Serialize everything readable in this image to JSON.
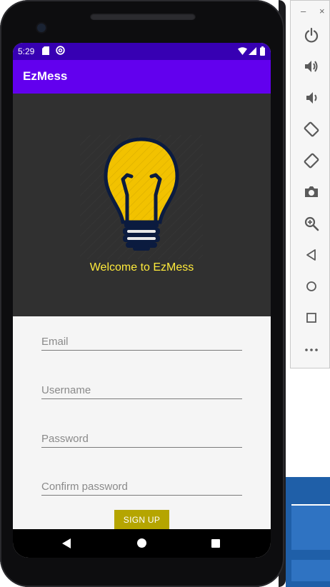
{
  "status_bar": {
    "time": "5:29",
    "icons": [
      "sd-card-icon",
      "at-sign-icon",
      "wifi-icon",
      "signal-icon",
      "battery-icon"
    ]
  },
  "app_bar": {
    "title": "EzMess"
  },
  "hero": {
    "logo_icon": "lightbulb-icon",
    "welcome_text": "Welcome to EzMess",
    "colors": {
      "background": "#303030",
      "welcome": "#ffeb3b",
      "bulb": "#f2c200"
    }
  },
  "form": {
    "email_placeholder": "Email",
    "username_placeholder": "Username",
    "password_placeholder": "Password",
    "confirm_password_placeholder": "Confirm password",
    "signup_label": "SIGN UP"
  },
  "nav_bar": {
    "icons": [
      "back-icon",
      "home-icon",
      "recents-icon"
    ]
  },
  "emulator_toolbar": {
    "window_controls": {
      "minimize": "–",
      "close": "×"
    },
    "buttons": [
      "power-icon",
      "volume-up-icon",
      "volume-down-icon",
      "rotate-left-icon",
      "rotate-right-icon",
      "camera-icon",
      "zoom-icon",
      "back-icon",
      "home-icon",
      "overview-icon",
      "more-icon"
    ]
  },
  "colors": {
    "status_bar": "#3700b3",
    "primary": "#6200ee",
    "signup_button": "#b5a500"
  }
}
